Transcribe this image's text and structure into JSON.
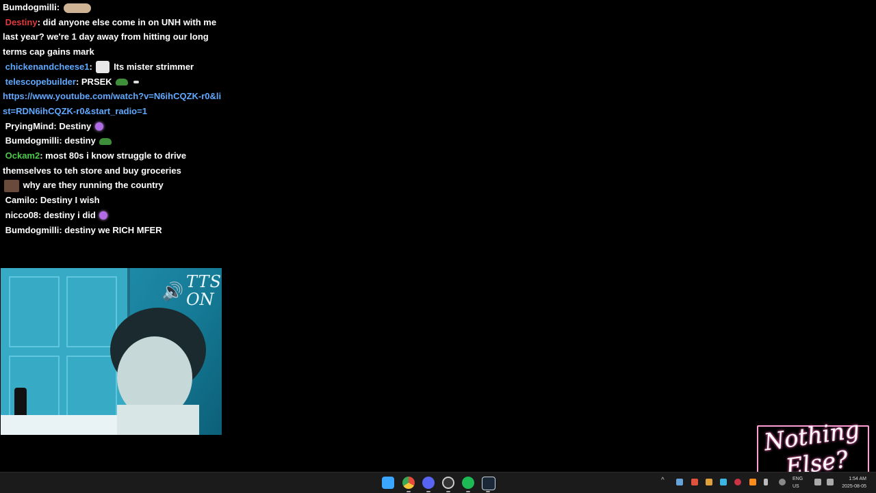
{
  "chat": {
    "messages": [
      {
        "user": "Bumdogmilli",
        "user_color": "#ffffff",
        "text": "",
        "emote": "arms"
      },
      {
        "user": "Destiny",
        "user_color": "#e03a3a",
        "text": "did anyone else come in on UNH with me last year? we're 1 day away from hitting our long terms cap gains mark",
        "emote": ""
      },
      {
        "user": "chickenandcheese1",
        "user_color": "#5fa9ff",
        "text": "Its mister strimmer",
        "emote": "bunny"
      },
      {
        "user": "telescopebuilder",
        "user_color": "#5fa9ff",
        "text": "PRSEK",
        "emote": "pepe",
        "link": "https://www.youtube.com/watch?v=N6ihCQZK-r0&list=RDN6ihCQZK-r0&start_radio=1"
      },
      {
        "user": "PryingMind",
        "user_color": "#ffffff",
        "text": "Destiny",
        "emote": "purple"
      },
      {
        "user": "Bumdogmilli",
        "user_color": "#ffffff",
        "text": "destiny",
        "emote": "pepe"
      },
      {
        "user": "Ockam2",
        "user_color": "#4cc94c",
        "text": "most 80s i know struggle to drive themselves to teh store and buy groceries",
        "emote": ""
      },
      {
        "user": "",
        "user_color": "#ffffff",
        "text": "why are they running the country",
        "emote": "face"
      },
      {
        "user": "Camilo",
        "user_color": "#ffffff",
        "text": "Destiny I wish",
        "emote": ""
      },
      {
        "user": "nicco08",
        "user_color": "#ffffff",
        "text": "destiny i did",
        "emote": "purple"
      },
      {
        "user": "Bumdogmilli",
        "user_color": "#ffffff",
        "text": "destiny we RICH MFER",
        "emote": ""
      }
    ]
  },
  "webcam": {
    "tts_line1": "TTS",
    "tts_line2": "ON",
    "speaker_icon": "speaker-icon"
  },
  "logo": {
    "line1": "Nothing",
    "line2": "Else?"
  },
  "taskbar": {
    "apps": [
      "windows-start-icon",
      "chrome-icon",
      "discord-icon",
      "obs-icon",
      "spotify-icon",
      "steam-icon"
    ],
    "lang_line1": "ENG",
    "lang_line2": "US",
    "time": "1:54 AM",
    "date": "2025-08-05"
  }
}
